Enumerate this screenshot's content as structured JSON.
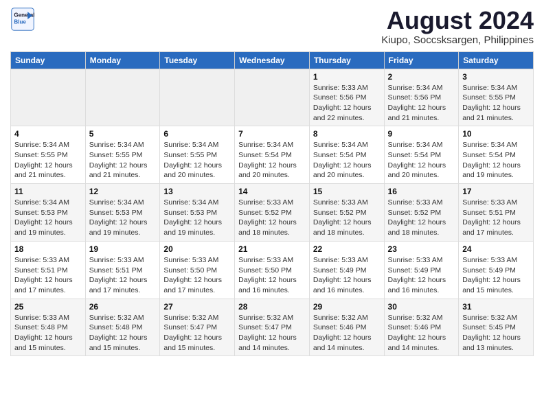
{
  "logo": {
    "line1": "General",
    "line2": "Blue"
  },
  "title": "August 2024",
  "subtitle": "Kiupo, Soccsksargen, Philippines",
  "days_of_week": [
    "Sunday",
    "Monday",
    "Tuesday",
    "Wednesday",
    "Thursday",
    "Friday",
    "Saturday"
  ],
  "weeks": [
    [
      {
        "day": "",
        "info": ""
      },
      {
        "day": "",
        "info": ""
      },
      {
        "day": "",
        "info": ""
      },
      {
        "day": "",
        "info": ""
      },
      {
        "day": "1",
        "info": "Sunrise: 5:33 AM\nSunset: 5:56 PM\nDaylight: 12 hours\nand 22 minutes."
      },
      {
        "day": "2",
        "info": "Sunrise: 5:34 AM\nSunset: 5:56 PM\nDaylight: 12 hours\nand 21 minutes."
      },
      {
        "day": "3",
        "info": "Sunrise: 5:34 AM\nSunset: 5:55 PM\nDaylight: 12 hours\nand 21 minutes."
      }
    ],
    [
      {
        "day": "4",
        "info": "Sunrise: 5:34 AM\nSunset: 5:55 PM\nDaylight: 12 hours\nand 21 minutes."
      },
      {
        "day": "5",
        "info": "Sunrise: 5:34 AM\nSunset: 5:55 PM\nDaylight: 12 hours\nand 21 minutes."
      },
      {
        "day": "6",
        "info": "Sunrise: 5:34 AM\nSunset: 5:55 PM\nDaylight: 12 hours\nand 20 minutes."
      },
      {
        "day": "7",
        "info": "Sunrise: 5:34 AM\nSunset: 5:54 PM\nDaylight: 12 hours\nand 20 minutes."
      },
      {
        "day": "8",
        "info": "Sunrise: 5:34 AM\nSunset: 5:54 PM\nDaylight: 12 hours\nand 20 minutes."
      },
      {
        "day": "9",
        "info": "Sunrise: 5:34 AM\nSunset: 5:54 PM\nDaylight: 12 hours\nand 20 minutes."
      },
      {
        "day": "10",
        "info": "Sunrise: 5:34 AM\nSunset: 5:54 PM\nDaylight: 12 hours\nand 19 minutes."
      }
    ],
    [
      {
        "day": "11",
        "info": "Sunrise: 5:34 AM\nSunset: 5:53 PM\nDaylight: 12 hours\nand 19 minutes."
      },
      {
        "day": "12",
        "info": "Sunrise: 5:34 AM\nSunset: 5:53 PM\nDaylight: 12 hours\nand 19 minutes."
      },
      {
        "day": "13",
        "info": "Sunrise: 5:34 AM\nSunset: 5:53 PM\nDaylight: 12 hours\nand 19 minutes."
      },
      {
        "day": "14",
        "info": "Sunrise: 5:33 AM\nSunset: 5:52 PM\nDaylight: 12 hours\nand 18 minutes."
      },
      {
        "day": "15",
        "info": "Sunrise: 5:33 AM\nSunset: 5:52 PM\nDaylight: 12 hours\nand 18 minutes."
      },
      {
        "day": "16",
        "info": "Sunrise: 5:33 AM\nSunset: 5:52 PM\nDaylight: 12 hours\nand 18 minutes."
      },
      {
        "day": "17",
        "info": "Sunrise: 5:33 AM\nSunset: 5:51 PM\nDaylight: 12 hours\nand 17 minutes."
      }
    ],
    [
      {
        "day": "18",
        "info": "Sunrise: 5:33 AM\nSunset: 5:51 PM\nDaylight: 12 hours\nand 17 minutes."
      },
      {
        "day": "19",
        "info": "Sunrise: 5:33 AM\nSunset: 5:51 PM\nDaylight: 12 hours\nand 17 minutes."
      },
      {
        "day": "20",
        "info": "Sunrise: 5:33 AM\nSunset: 5:50 PM\nDaylight: 12 hours\nand 17 minutes."
      },
      {
        "day": "21",
        "info": "Sunrise: 5:33 AM\nSunset: 5:50 PM\nDaylight: 12 hours\nand 16 minutes."
      },
      {
        "day": "22",
        "info": "Sunrise: 5:33 AM\nSunset: 5:49 PM\nDaylight: 12 hours\nand 16 minutes."
      },
      {
        "day": "23",
        "info": "Sunrise: 5:33 AM\nSunset: 5:49 PM\nDaylight: 12 hours\nand 16 minutes."
      },
      {
        "day": "24",
        "info": "Sunrise: 5:33 AM\nSunset: 5:49 PM\nDaylight: 12 hours\nand 15 minutes."
      }
    ],
    [
      {
        "day": "25",
        "info": "Sunrise: 5:33 AM\nSunset: 5:48 PM\nDaylight: 12 hours\nand 15 minutes."
      },
      {
        "day": "26",
        "info": "Sunrise: 5:32 AM\nSunset: 5:48 PM\nDaylight: 12 hours\nand 15 minutes."
      },
      {
        "day": "27",
        "info": "Sunrise: 5:32 AM\nSunset: 5:47 PM\nDaylight: 12 hours\nand 15 minutes."
      },
      {
        "day": "28",
        "info": "Sunrise: 5:32 AM\nSunset: 5:47 PM\nDaylight: 12 hours\nand 14 minutes."
      },
      {
        "day": "29",
        "info": "Sunrise: 5:32 AM\nSunset: 5:46 PM\nDaylight: 12 hours\nand 14 minutes."
      },
      {
        "day": "30",
        "info": "Sunrise: 5:32 AM\nSunset: 5:46 PM\nDaylight: 12 hours\nand 14 minutes."
      },
      {
        "day": "31",
        "info": "Sunrise: 5:32 AM\nSunset: 5:45 PM\nDaylight: 12 hours\nand 13 minutes."
      }
    ]
  ]
}
